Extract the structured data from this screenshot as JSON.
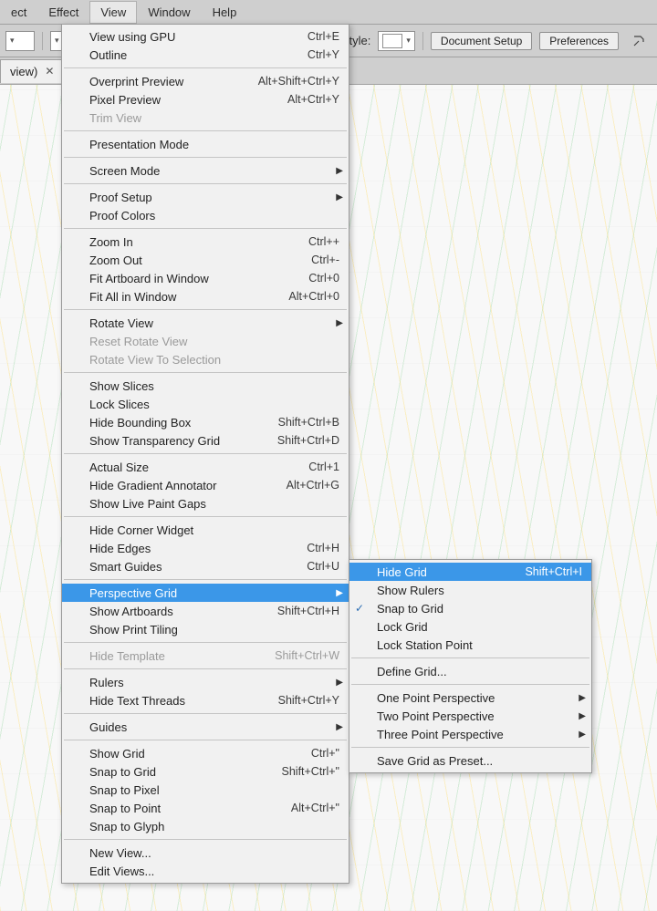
{
  "menubar": {
    "items": [
      "ect",
      "Effect",
      "View",
      "Window",
      "Help"
    ],
    "active": 2
  },
  "optbar": {
    "style_label": "Style:",
    "btn_docsetup": "Document Setup",
    "btn_prefs": "Preferences"
  },
  "tab": {
    "name": "view)"
  },
  "view_menu": {
    "groups": [
      [
        {
          "label": "View using GPU",
          "shortcut": "Ctrl+E"
        },
        {
          "label": "Outline",
          "shortcut": "Ctrl+Y"
        }
      ],
      [
        {
          "label": "Overprint Preview",
          "shortcut": "Alt+Shift+Ctrl+Y"
        },
        {
          "label": "Pixel Preview",
          "shortcut": "Alt+Ctrl+Y"
        },
        {
          "label": "Trim View",
          "disabled": true
        }
      ],
      [
        {
          "label": "Presentation Mode"
        }
      ],
      [
        {
          "label": "Screen Mode",
          "submenu": true
        }
      ],
      [
        {
          "label": "Proof Setup",
          "submenu": true
        },
        {
          "label": "Proof Colors"
        }
      ],
      [
        {
          "label": "Zoom In",
          "shortcut": "Ctrl++"
        },
        {
          "label": "Zoom Out",
          "shortcut": "Ctrl+-"
        },
        {
          "label": "Fit Artboard in Window",
          "shortcut": "Ctrl+0"
        },
        {
          "label": "Fit All in Window",
          "shortcut": "Alt+Ctrl+0"
        }
      ],
      [
        {
          "label": "Rotate View",
          "submenu": true
        },
        {
          "label": "Reset Rotate View",
          "disabled": true
        },
        {
          "label": "Rotate View To Selection",
          "disabled": true
        }
      ],
      [
        {
          "label": "Show Slices"
        },
        {
          "label": "Lock Slices"
        },
        {
          "label": "Hide Bounding Box",
          "shortcut": "Shift+Ctrl+B"
        },
        {
          "label": "Show Transparency Grid",
          "shortcut": "Shift+Ctrl+D"
        }
      ],
      [
        {
          "label": "Actual Size",
          "shortcut": "Ctrl+1"
        },
        {
          "label": "Hide Gradient Annotator",
          "shortcut": "Alt+Ctrl+G"
        },
        {
          "label": "Show Live Paint Gaps"
        }
      ],
      [
        {
          "label": "Hide Corner Widget"
        },
        {
          "label": "Hide Edges",
          "shortcut": "Ctrl+H"
        },
        {
          "label": "Smart Guides",
          "shortcut": "Ctrl+U"
        }
      ],
      [
        {
          "label": "Perspective Grid",
          "submenu": true,
          "highlight": true
        },
        {
          "label": "Show Artboards",
          "shortcut": "Shift+Ctrl+H"
        },
        {
          "label": "Show Print Tiling"
        }
      ],
      [
        {
          "label": "Hide Template",
          "shortcut": "Shift+Ctrl+W",
          "disabled": true
        }
      ],
      [
        {
          "label": "Rulers",
          "submenu": true
        },
        {
          "label": "Hide Text Threads",
          "shortcut": "Shift+Ctrl+Y"
        }
      ],
      [
        {
          "label": "Guides",
          "submenu": true
        }
      ],
      [
        {
          "label": "Show Grid",
          "shortcut": "Ctrl+\""
        },
        {
          "label": "Snap to Grid",
          "shortcut": "Shift+Ctrl+\""
        },
        {
          "label": "Snap to Pixel"
        },
        {
          "label": "Snap to Point",
          "shortcut": "Alt+Ctrl+\""
        },
        {
          "label": "Snap to Glyph"
        }
      ],
      [
        {
          "label": "New View..."
        },
        {
          "label": "Edit Views..."
        }
      ]
    ]
  },
  "perspective_submenu": {
    "groups": [
      [
        {
          "label": "Hide Grid",
          "shortcut": "Shift+Ctrl+I",
          "highlight": true
        },
        {
          "label": "Show Rulers"
        },
        {
          "label": "Snap to Grid",
          "checked": true
        },
        {
          "label": "Lock Grid"
        },
        {
          "label": "Lock Station Point"
        }
      ],
      [
        {
          "label": "Define Grid..."
        }
      ],
      [
        {
          "label": "One Point Perspective",
          "submenu": true
        },
        {
          "label": "Two Point Perspective",
          "submenu": true
        },
        {
          "label": "Three Point Perspective",
          "submenu": true
        }
      ],
      [
        {
          "label": "Save Grid as Preset..."
        }
      ]
    ]
  }
}
